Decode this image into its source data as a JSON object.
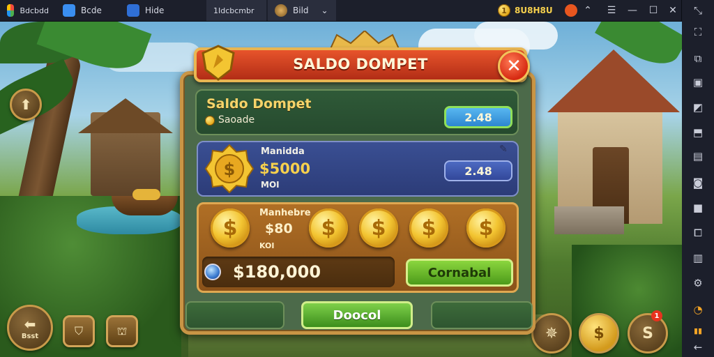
{
  "emulator": {
    "tabs": [
      {
        "label": "Bdcbdd",
        "icon": "app-icon"
      },
      {
        "label": "Bcde",
        "icon": "home-icon"
      },
      {
        "label": "Hide",
        "icon": "window-icon"
      },
      {
        "label": "1Idcbcmbr",
        "icon": ""
      },
      {
        "label": "Bild",
        "icon": "game-icon"
      }
    ],
    "coin_balance": "8U8H8U",
    "colors": {
      "bar": "#1c1f2b",
      "active_tab": "#2a2e3d"
    },
    "top_icons": [
      "fire-icon",
      "hide-icon",
      "menu-icon",
      "minimize-icon",
      "maximize-icon",
      "close-icon",
      "expand-icon"
    ],
    "sidebar_icons": [
      "fullscreen-icon",
      "screenshot-icon",
      "record-icon",
      "volume-icon",
      "apk-icon",
      "folder-icon",
      "camera-icon",
      "keyboard-icon",
      "multi-instance-icon",
      "settings-icon",
      "gauge-icon",
      "back-icon"
    ]
  },
  "hud": {
    "up_button": "up-arrow-icon",
    "back_label": "Bsst",
    "bottom_right_badge": "1"
  },
  "dialog": {
    "title": "SALDO DOMPET",
    "close_symbol": "✕",
    "balance": {
      "heading": "Saldo Dompet",
      "sub": "Saoade",
      "value": "2.48"
    },
    "bank": {
      "label": "Manidda",
      "amount": "$5000",
      "unit": "MOI",
      "value": "2.48"
    },
    "coins": {
      "label": "Manhebre",
      "amount": "$80",
      "unit": "KOI",
      "total": "$180,000",
      "confirm_label": "Cornabal"
    },
    "footer_button": "Doocol",
    "coin_symbol": "$"
  }
}
